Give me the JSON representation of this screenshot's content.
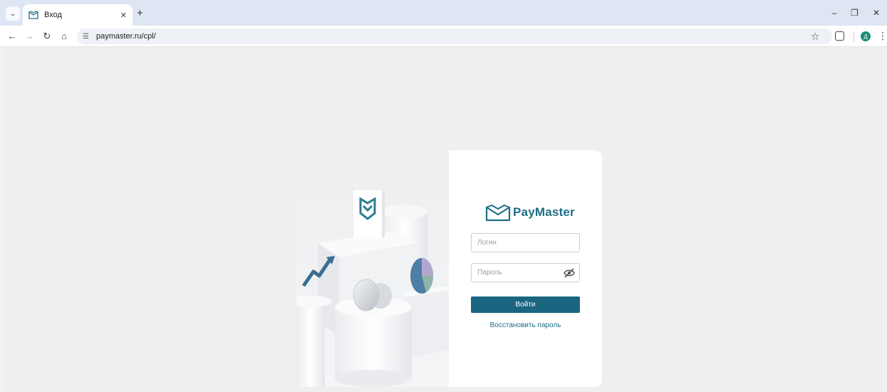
{
  "browser": {
    "tab_title": "Вход",
    "url": "paymaster.ru/cpl/",
    "profile_initial": "Д"
  },
  "brand": {
    "name": "PayMaster",
    "color": "#1d6f86"
  },
  "login_form": {
    "login_placeholder": "Логин",
    "password_placeholder": "Пароль",
    "submit_label": "Войти",
    "restore_link": "Восстановить пароль",
    "button_color": "#1a6680"
  },
  "icons": {
    "tab_list": "chevron-down-icon",
    "favicon": "paymaster-logo-icon",
    "back": "arrow-left-icon",
    "forward": "arrow-right-icon",
    "reload": "reload-icon",
    "home": "home-icon",
    "site_info": "tune-icon",
    "bookmark": "star-icon",
    "extensions": "puzzle-icon",
    "menu": "more-vert-icon",
    "password_toggle": "eye-off-icon"
  }
}
